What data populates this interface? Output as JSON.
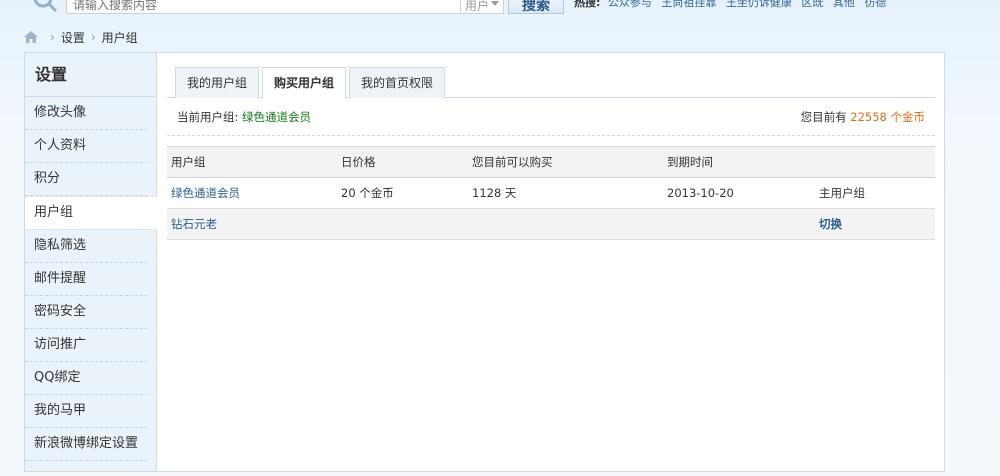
{
  "search": {
    "placeholder": "请输入搜索内容",
    "type_selected": "用户",
    "button_label": "搜索",
    "hot_label": "热搜:",
    "hot_items": [
      "公众参与",
      "王尚祖挂靠",
      "王坐仍诉健康",
      "区既",
      "其他",
      "彷德"
    ]
  },
  "breadcrumb": {
    "items": [
      "设置",
      "用户组"
    ]
  },
  "sidebar": {
    "title": "设置",
    "items": [
      {
        "label": "修改头像"
      },
      {
        "label": "个人资料"
      },
      {
        "label": "积分"
      },
      {
        "label": "用户组"
      },
      {
        "label": "隐私筛选"
      },
      {
        "label": "邮件提醒"
      },
      {
        "label": "密码安全"
      },
      {
        "label": "访问推广"
      },
      {
        "label": "QQ绑定"
      },
      {
        "label": "我的马甲"
      },
      {
        "label": "新浪微博绑定设置"
      }
    ],
    "active_index": 3
  },
  "tabs": [
    {
      "label": "我的用户组"
    },
    {
      "label": "购买用户组"
    },
    {
      "label": "我的首页权限"
    }
  ],
  "status": {
    "current_group_label": "当前用户组: ",
    "current_group_value": "绿色通道会员",
    "coins_prefix": "您目前有 ",
    "coins_value": "22558 个金币"
  },
  "table": {
    "headers": [
      "用户组",
      "日价格",
      "您目前可以购买",
      "到期时间",
      ""
    ],
    "rows": [
      {
        "group": "绿色通道会员",
        "price": "20 个金币",
        "can_buy": "1128 天",
        "expire": "2013-10-20",
        "action": "主用户组"
      },
      {
        "group": "钻石元老",
        "price": "",
        "can_buy": "",
        "expire": "",
        "action": "切换"
      }
    ]
  },
  "colors": {
    "accent_link": "#2b5f94",
    "group_green": "#1a7a1a",
    "coins_orange": "#e36b17",
    "sidebar_bg": "#eaf2fa"
  }
}
